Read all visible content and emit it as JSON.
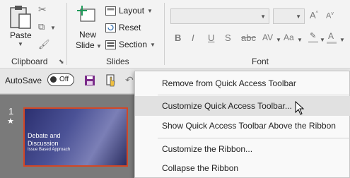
{
  "ribbon": {
    "clipboard": {
      "paste_label": "Paste",
      "group_label": "Clipboard"
    },
    "slides": {
      "new_slide_label": "New",
      "new_slide_label2": "Slide",
      "layout_label": "Layout",
      "reset_label": "Reset",
      "section_label": "Section",
      "group_label": "Slides"
    },
    "font": {
      "group_label": "Font",
      "bold": "B",
      "italic": "I",
      "underline": "U",
      "strike": "S",
      "char_spacing": "AV",
      "case": "Aa"
    }
  },
  "qat": {
    "autosave_label": "AutoSave",
    "toggle_state": "Off"
  },
  "slide": {
    "number": "1",
    "marker": "★",
    "title_line1": "Debate and",
    "title_line2": "Discussion",
    "subtitle": "Issue Based Approach"
  },
  "menu": {
    "items": [
      "Remove from Quick Access Toolbar",
      "Customize Quick Access Toolbar...",
      "Show Quick Access Toolbar Above the Ribbon",
      "Customize the Ribbon...",
      "Collapse the Ribbon"
    ],
    "highlighted_index": 1
  },
  "colors": {
    "accent": "#d24726",
    "ribbon_bg": "#f3f3f3",
    "menu_bg": "#f9f9f9",
    "menu_highlight": "#e1e1e1"
  }
}
